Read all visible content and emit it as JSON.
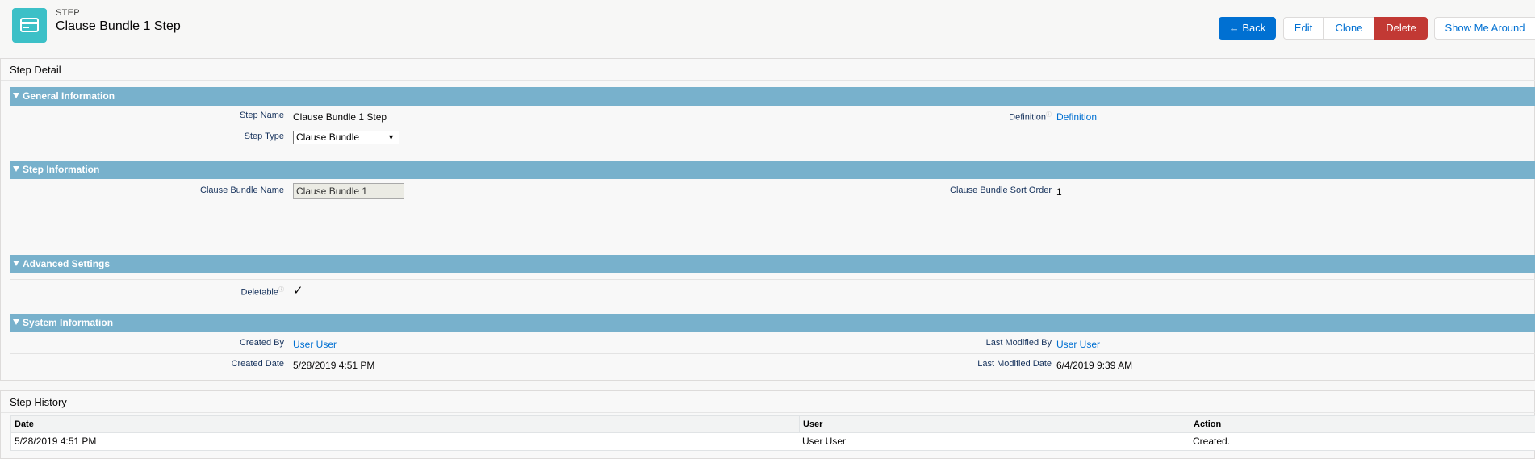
{
  "header": {
    "object_type": "Step",
    "title": "Clause Bundle 1 Step",
    "icon": "card-icon",
    "icon_color": "#3cc0c7"
  },
  "actions": {
    "back": "← Back",
    "edit": "Edit",
    "clone": "Clone",
    "delete": "Delete",
    "show_me_around": "Show Me Around"
  },
  "detail": {
    "title": "Step Detail",
    "general": {
      "heading": "General Information",
      "step_name_label": "Step Name",
      "step_name_value": "Clause Bundle 1 Step",
      "definition_label": "Definition",
      "definition_value": "Definition",
      "step_type_label": "Step Type",
      "step_type_value": "Clause Bundle"
    },
    "step_info": {
      "heading": "Step Information",
      "bundle_name_label": "Clause Bundle Name",
      "bundle_name_value": "Clause Bundle 1",
      "sort_order_label": "Clause Bundle Sort Order",
      "sort_order_value": "1"
    },
    "advanced": {
      "heading": "Advanced Settings",
      "deletable_label": "Deletable",
      "deletable_checked": true
    },
    "system": {
      "heading": "System Information",
      "created_by_label": "Created By",
      "created_by_value": "User User",
      "modified_by_label": "Last Modified By",
      "modified_by_value": "User User",
      "created_date_label": "Created Date",
      "created_date_value": "5/28/2019 4:51 PM",
      "modified_date_label": "Last Modified Date",
      "modified_date_value": "6/4/2019 9:39 AM"
    }
  },
  "history": {
    "title": "Step History",
    "columns": [
      "Date",
      "User",
      "Action"
    ],
    "rows": [
      {
        "date": "5/28/2019 4:51 PM",
        "user": "User User",
        "action": "Created."
      }
    ]
  },
  "colors": {
    "section_bar": "#78b1cc",
    "primary": "#0070d2",
    "destructive": "#c23934"
  }
}
